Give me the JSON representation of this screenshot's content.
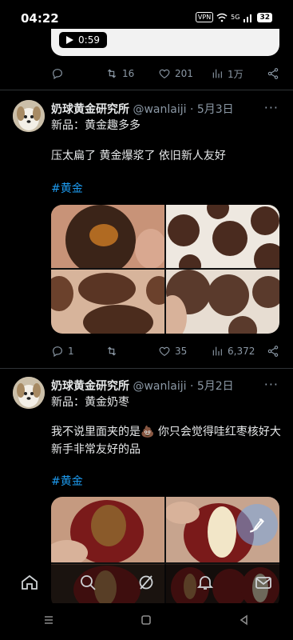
{
  "status": {
    "time": "04:22",
    "vpn": "VPN",
    "network": "5G",
    "battery": "32"
  },
  "video": {
    "duration": "0:59"
  },
  "prev_actions": {
    "retweets": "16",
    "likes": "201",
    "views": "1万"
  },
  "tweets": [
    {
      "name": "奶球黄金研究所",
      "handle": "@wanlaiji",
      "date": "· 5月3日",
      "line1": "新品：黄金趣多多",
      "line2": "压太扁了 黄金爆浆了 依旧新人友好",
      "hashtag": "#黄金",
      "actions": {
        "replies": "1",
        "retweets": "",
        "likes": "35",
        "views": "6,372"
      }
    },
    {
      "name": "奶球黄金研究所",
      "handle": "@wanlaiji",
      "date": "· 5月2日",
      "line1": "新品：黄金奶枣",
      "line2": "我不说里面夹的是💩 你只会觉得哇红枣核好大 新手非常友好的品",
      "hashtag": "#黄金"
    }
  ],
  "more_label": "···",
  "colors": {
    "accent": "#1d9bf0",
    "muted": "#8b98a5",
    "background": "#000000"
  },
  "icons": {
    "reply": "reply-icon",
    "retweet": "retweet-icon",
    "like": "heart-icon",
    "views": "views-icon",
    "share": "share-icon",
    "nav_home": "home-icon",
    "nav_search": "search-icon",
    "nav_grok": "grok-icon",
    "nav_notifications": "bell-icon",
    "nav_messages": "mail-icon",
    "compose": "compose-icon",
    "sys_menu": "menu-icon",
    "sys_home": "square-icon",
    "sys_back": "back-icon"
  }
}
